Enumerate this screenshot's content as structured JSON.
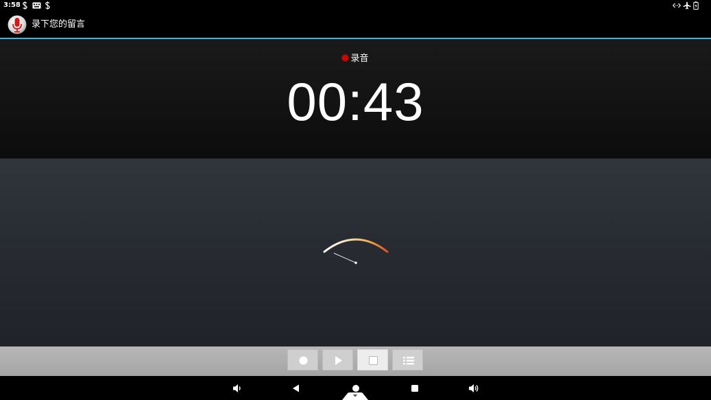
{
  "status_bar": {
    "time": "3:58",
    "left_icons": [
      "s-notification-icon",
      "keyboard-icon",
      "s-notification-icon"
    ],
    "right_icons": [
      "ethernet-icon",
      "airplane-mode-icon",
      "battery-icon"
    ]
  },
  "action_bar": {
    "icon": "microphone-icon",
    "title": "录下您的留言"
  },
  "recorder": {
    "status": "录音",
    "elapsed": "00:43",
    "meter_icon": "vu-meter-needle"
  },
  "controls": [
    {
      "name": "record-button",
      "icon": "record-icon",
      "active": false
    },
    {
      "name": "play-button",
      "icon": "play-icon",
      "active": false
    },
    {
      "name": "stop-button",
      "icon": "stop-icon",
      "active": true
    },
    {
      "name": "list-button",
      "icon": "list-icon",
      "active": false
    }
  ],
  "nav_bar": {
    "items": [
      "volume-down-icon",
      "back-icon",
      "home-icon",
      "recents-icon",
      "volume-up-icon"
    ]
  },
  "colors": {
    "accent": "#33b5e5",
    "record_dot": "#d40000",
    "meter_start": "#ffffff",
    "meter_end": "#e8501a"
  }
}
